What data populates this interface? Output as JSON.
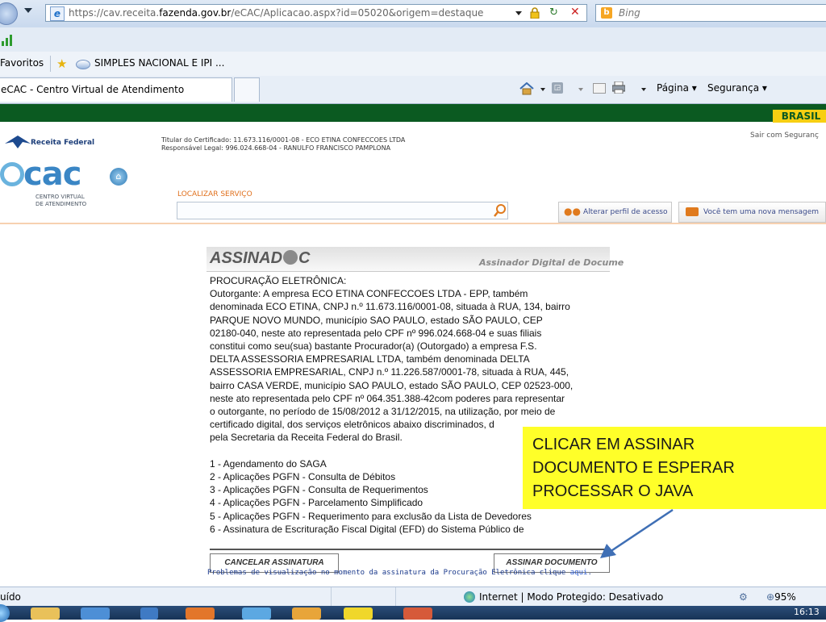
{
  "browser": {
    "url_domain_prefix": "https://cav.receita.",
    "url_domain_bold": "fazenda.gov.br",
    "url_path": "/eCAC/Aplicacao.aspx?id=05020&origem=destaque",
    "search_placeholder": "Bing",
    "favorites_label": "Favoritos",
    "favorite_item": "SIMPLES NACIONAL E IPI ...",
    "tab_title": "eCAC - Centro Virtual de Atendimento",
    "menu_pagina": "Página",
    "menu_seguranca": "Segurança",
    "status_left": "uído",
    "status_zone": "Internet | Modo Protegido: Desativado",
    "zoom": "95%",
    "clock": "16:13"
  },
  "header": {
    "brasil": "BRASIL",
    "logout": "Sair com Seguranç",
    "receita_logo": "Receita Federal",
    "ecac_logo": "cac",
    "ecac_sub1": "CENTRO VIRTUAL",
    "ecac_sub2": "DE ATENDIMENTO",
    "titular": "Titular do Certificado: 11.673.116/0001-08 - ECO ETINA CONFECCOES LTDA",
    "responsavel": "Responsável Legal: 996.024.668-04 - RANULFO FRANCISCO PAMPLONA",
    "localizar_label": "LOCALIZAR SERVIÇO",
    "btn_perfil": "Alterar perfil de acesso",
    "btn_mensagem": "Você tem uma nova mensagem"
  },
  "applet": {
    "logo": "ASSINAD",
    "logo_suffix": "C",
    "subtitle": "Assinador Digital de Docume",
    "lines": [
      "PROCURAÇÃO ELETRÔNICA:",
      "Outorgante: A empresa ECO ETINA CONFECCOES LTDA - EPP, também",
      "denominada ECO ETINA, CNPJ n.º 11.673.116/0001-08, situada à RUA, 134, bairro",
      "PARQUE NOVO MUNDO, município SAO PAULO, estado SÃO PAULO, CEP",
      "02180-040, neste ato representada pelo CPF nº 996.024.668-04 e suas filiais",
      "constitui como seu(sua) bastante Procurador(a) (Outorgado)  a empresa F.S.",
      "DELTA ASSESSORIA EMPRESARIAL LTDA, também denominada DELTA",
      "ASSESSORIA EMPRESARIAL, CNPJ n.º 11.226.587/0001-78, situada à RUA, 445,",
      "bairro CASA VERDE, município SAO PAULO, estado SÃO PAULO, CEP 02523-000,",
      "neste ato representada pelo CPF nº 064.351.388-42com poderes para representar",
      "o outorgante, no período de 15/08/2012 a 31/12/2015, na utilização, por meio de",
      "certificado digital, dos serviços eletrônicos abaixo discriminados, d",
      "pela Secretaria da Receita Federal do Brasil.",
      "",
      "1 - Agendamento do SAGA",
      "2 - Aplicações PGFN - Consulta de Débitos",
      "3 - Aplicações PGFN - Consulta de Requerimentos",
      "4 - Aplicações PGFN - Parcelamento Simplificado",
      "5 - Aplicações PGFN - Requerimento para exclusão da Lista de Devedores",
      "6 - Assinatura de Escrituração Fiscal Digital (EFD) do Sistema Público de"
    ],
    "btn_cancel": "CANCELAR ASSINATURA",
    "btn_sign": "ASSINAR DOCUMENTO",
    "problem_text": "Problemas de visualização no momento da assinatura da Procuração Eletrônica clique",
    "problem_link": "aqui",
    "problem_end": "."
  },
  "callout": {
    "lines": [
      "CLICAR EM ASSINAR",
      "DOCUMENTO E ESPERAR",
      "PROCESSAR O JAVA"
    ]
  },
  "colors": {
    "gov_green": "#0b5a21",
    "brasil_yellow": "#f7cf12",
    "callout_yellow": "#ffff29",
    "arrow_blue": "#3f6fb5",
    "ecac_blue": "#2a78b5"
  }
}
